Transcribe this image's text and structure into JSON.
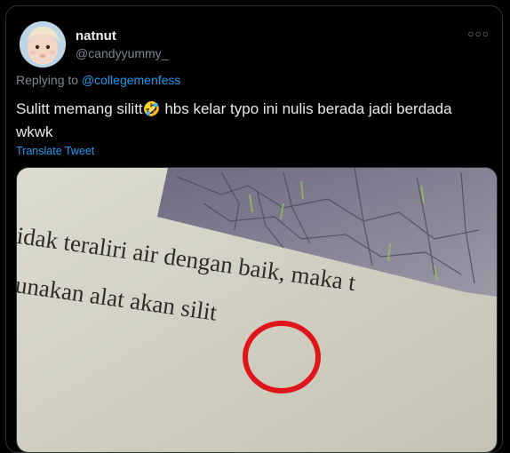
{
  "tweet": {
    "display_name": "natnut",
    "handle": "@candyyummy_",
    "more_icon": "ellipsis-icon",
    "reply_prefix": "Replying to",
    "reply_mention": "@collegemenfess",
    "text_before_emoji": "Sulitt memang silitt",
    "emoji": "🤣",
    "emoji_name": "rolling-on-floor-laughing-emoji",
    "text_after_emoji": " hbs kelar typo ini nulis berada jadi berdada wkwk",
    "translate_label": "Translate Tweet"
  },
  "media": {
    "book_line_1": "tidak teralirі air dengan baik, maka t",
    "book_line_2": "gunakan alat akan silit",
    "circle_color": "#e0151b",
    "page_color": "#d4d3c6"
  }
}
